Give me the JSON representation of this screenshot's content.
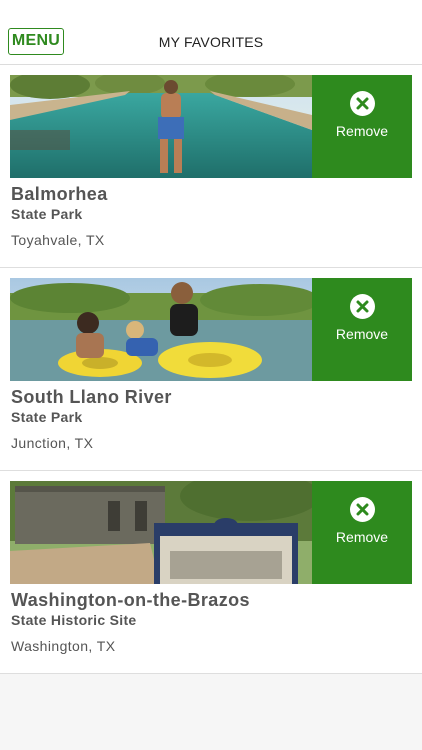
{
  "header": {
    "menu_label": "MENU",
    "title": "MY FAVORITES"
  },
  "favorites": [
    {
      "name": "Balmorhea",
      "type": "State Park",
      "location": "Toyahvale, TX",
      "remove_label": "Remove"
    },
    {
      "name": "South Llano River",
      "type": "State Park",
      "location": "Junction, TX",
      "remove_label": "Remove"
    },
    {
      "name": "Washington-on-the-Brazos",
      "type": "State Historic Site",
      "location": "Washington, TX",
      "remove_label": "Remove"
    }
  ],
  "colors": {
    "accent": "#2e8a1e",
    "text": "#555555"
  }
}
